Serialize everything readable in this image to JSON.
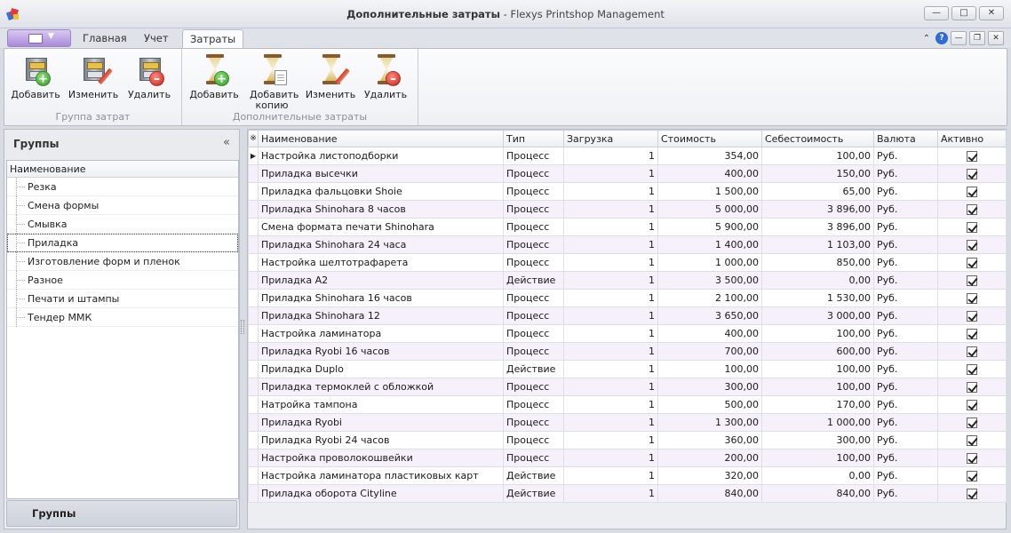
{
  "window": {
    "title_bold": "Дополнительные затраты",
    "title_rest": " - Flexys Printshop Management"
  },
  "ribbon_tabs": [
    "Главная",
    "Учет",
    "Затраты"
  ],
  "ribbon": {
    "group1": {
      "label": "Группа затрат",
      "buttons": [
        "Добавить",
        "Изменить",
        "Удалить"
      ]
    },
    "group2": {
      "label": "Дополнительные затраты",
      "buttons": [
        "Добавить",
        "Добавить копию",
        "Изменить",
        "Удалить"
      ]
    }
  },
  "left_panel": {
    "title": "Группы",
    "tree_header": "Наименование",
    "items": [
      "Резка",
      "Смена формы",
      "Смывка",
      "Приладка",
      "Изготовление форм и пленок",
      "Разное",
      "Печати и штампы",
      "Тендер ММК"
    ],
    "selected_index": 3,
    "bottom_label": "Группы"
  },
  "grid": {
    "columns": [
      "Наименование",
      "Тип",
      "Загрузка",
      "Стоимость",
      "Себестоимость",
      "Валюта",
      "Активно"
    ],
    "rows": [
      [
        "Настройка листоподборки",
        "Процесс",
        "1",
        "354,00",
        "100,00",
        "Руб."
      ],
      [
        "Приладка высечки",
        "Процесс",
        "1",
        "400,00",
        "150,00",
        "Руб."
      ],
      [
        "Приладка фальцовки Shoie",
        "Процесс",
        "1",
        "1 500,00",
        "65,00",
        "Руб."
      ],
      [
        "Приладка Shinohara 8 часов",
        "Процесс",
        "1",
        "5 000,00",
        "3 896,00",
        "Руб."
      ],
      [
        "Смена формата печати Shinohara",
        "Процесс",
        "1",
        "5 900,00",
        "3 896,00",
        "Руб."
      ],
      [
        "Приладка Shinohara 24 часа",
        "Процесс",
        "1",
        "1 400,00",
        "1 103,00",
        "Руб."
      ],
      [
        "Настройка шелтотрафарета",
        "Процесс",
        "1",
        "1 000,00",
        "850,00",
        "Руб."
      ],
      [
        "Приладка А2",
        "Действие",
        "1",
        "3 500,00",
        "0,00",
        "Руб."
      ],
      [
        "Приладка Shinohara 16 часов",
        "Процесс",
        "1",
        "2 100,00",
        "1 530,00",
        "Руб."
      ],
      [
        "Приладка Shinohara 12",
        "Процесс",
        "1",
        "3 650,00",
        "3 000,00",
        "Руб."
      ],
      [
        "Настройка ламинатора",
        "Процесс",
        "1",
        "400,00",
        "100,00",
        "Руб."
      ],
      [
        "Приладка Ryobi 16 часов",
        "Процесс",
        "1",
        "700,00",
        "600,00",
        "Руб."
      ],
      [
        "Приладка Duplo",
        "Действие",
        "1",
        "100,00",
        "100,00",
        "Руб."
      ],
      [
        "Приладка термоклей с обложкой",
        "Процесс",
        "1",
        "300,00",
        "100,00",
        "Руб."
      ],
      [
        "Натройка тампона",
        "Процесс",
        "1",
        "500,00",
        "170,00",
        "Руб."
      ],
      [
        "Приладка Ryobi",
        "Процесс",
        "1",
        "1 300,00",
        "1 000,00",
        "Руб."
      ],
      [
        "Приладка Ryobi 24 часов",
        "Процесс",
        "1",
        "360,00",
        "300,00",
        "Руб."
      ],
      [
        "Настройка проволокошвейки",
        "Процесс",
        "1",
        "200,00",
        "100,00",
        "Руб."
      ],
      [
        "Настройка ламинатора пластиковых карт",
        "Действие",
        "1",
        "320,00",
        "0,00",
        "Руб."
      ],
      [
        "Приладка оборота Cityline",
        "Действие",
        "1",
        "840,00",
        "840,00",
        "Руб."
      ]
    ]
  }
}
